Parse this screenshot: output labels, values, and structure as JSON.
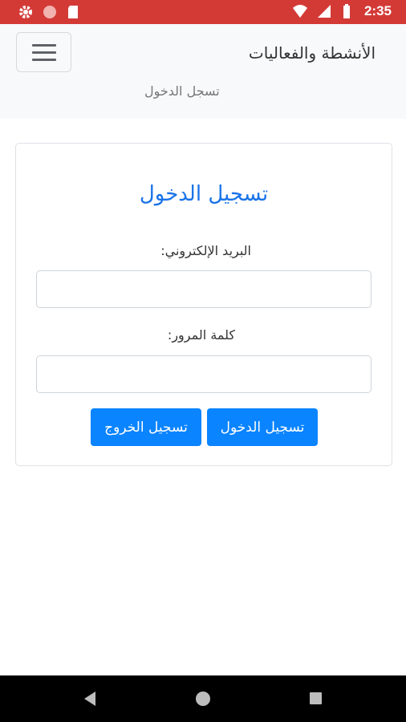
{
  "status_bar": {
    "time": "2:35",
    "left_icons": [
      "gear-icon",
      "circle-icon",
      "sd-card-icon"
    ],
    "right_icons": [
      "wifi-icon",
      "signal-icon",
      "battery-icon"
    ],
    "background": "#d33a36"
  },
  "navbar": {
    "brand": "الأنشطة والفعاليات",
    "link": "تسجل الدخول",
    "toggler_icon": "hamburger-menu-icon"
  },
  "login_card": {
    "title": "تسجيل الدخول",
    "email_label": "البريد الإلكتروني:",
    "email_value": "",
    "password_label": "كلمة المرور:",
    "password_value": "",
    "login_button": "تسجيل الدخول",
    "logout_button": "تسجيل الخروج",
    "accent_color": "#0a84ff"
  },
  "android_nav": {
    "icons": [
      "back-icon",
      "home-icon",
      "recent-apps-icon"
    ]
  }
}
